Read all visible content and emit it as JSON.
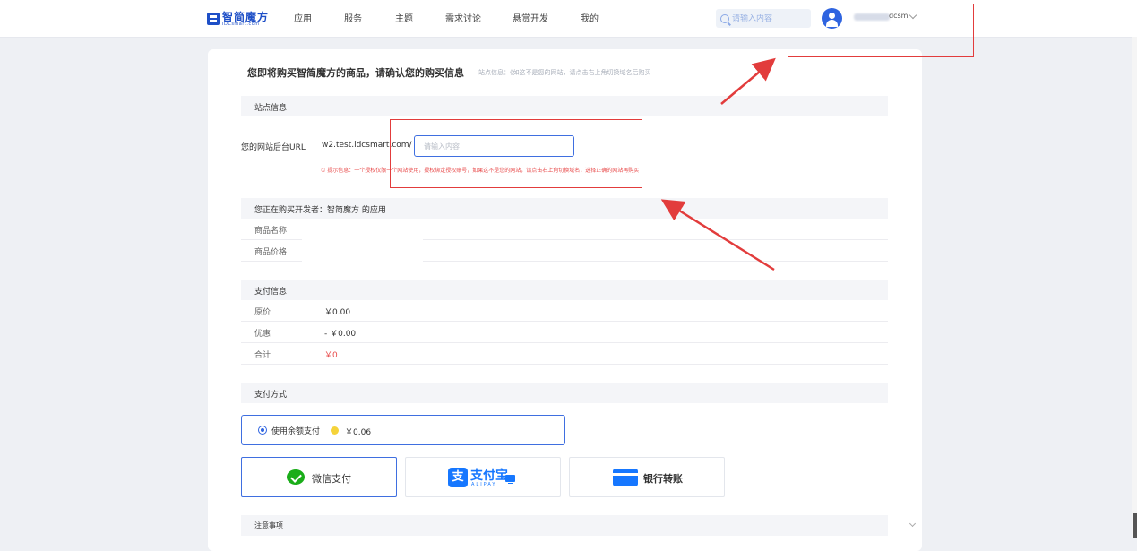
{
  "header": {
    "logo_cn": "智简魔方",
    "logo_en": "IDCsmart.com",
    "nav": [
      "应用",
      "服务",
      "主题",
      "需求讨论",
      "悬赏开发",
      "我的"
    ],
    "search_placeholder": "请输入内容",
    "username": "dcsm"
  },
  "page": {
    "title": "您即将购买智简魔方的商品，请确认您的购买信息",
    "site_note": "站点信息：《如这不是您的网站，请点击右上角切换域名后购买"
  },
  "site_section": {
    "header": "站点信息",
    "url_label": "您的网站后台URL",
    "url_domain": "w2.test.idcsmart.com/",
    "url_placeholder": "请输入内容",
    "tip": "① 提示信息：一个授权仅限一个网站使用，授权绑定授权账号，如果这不是您的网站，请点击右上角切换域名，选择正确的网站再购买"
  },
  "product_section": {
    "header": "您正在购买开发者：智简魔方 的应用",
    "name_label": "商品名称",
    "price_label": "商品价格"
  },
  "payment_info": {
    "header": "支付信息",
    "rows": [
      {
        "label": "原价",
        "value": "￥0.00"
      },
      {
        "label": "优惠",
        "value": "- ￥0.00"
      },
      {
        "label": "合计",
        "value": "￥0"
      }
    ],
    "total_color": "#e84b4b"
  },
  "payment_method": {
    "header": "支付方式",
    "balance_label": "使用余额支付",
    "balance_amount": "￥0.06",
    "wechat": "微信支付",
    "alipay": "支付宝",
    "alipay_en": "ALIPAY",
    "alipay_icon_char": "支",
    "bank": "银行转账"
  },
  "notes": {
    "header": "注意事项"
  },
  "colors": {
    "accent": "#2f64e0",
    "annotation": "#e23c3c",
    "wechat": "#1aad19",
    "alipay": "#1677ff"
  }
}
